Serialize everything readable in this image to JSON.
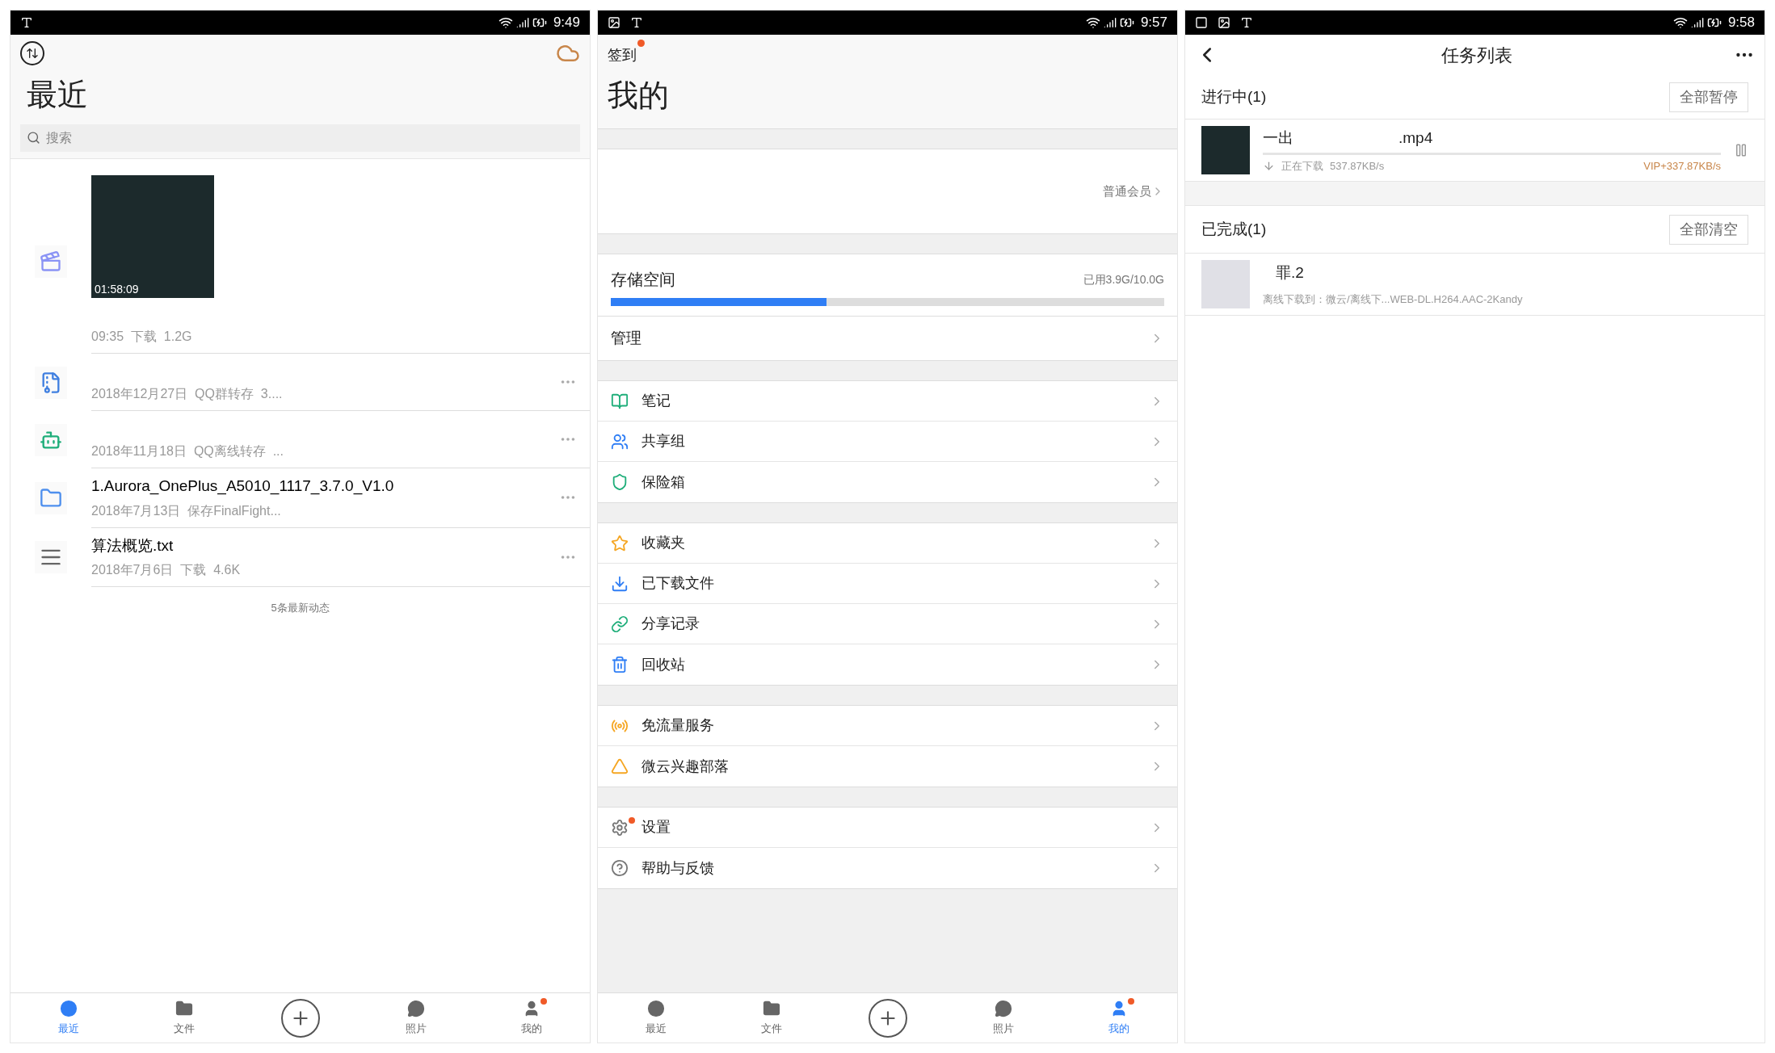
{
  "recent_screen": {
    "status_bar": {
      "time": "9:49"
    },
    "title": "最近",
    "search": {
      "placeholder": "搜索"
    },
    "items": [
      {
        "kind": "video",
        "duration": "01:58:09",
        "meta": "09:35  下载  1.2G"
      },
      {
        "kind": "archive",
        "meta": "2018年12月27日  QQ群转存  3...."
      },
      {
        "kind": "apk",
        "meta": "2018年11月18日  QQ离线转存  ..."
      },
      {
        "kind": "folder",
        "name": "1.Aurora_OnePlus_A5010_1117_3.7.0_V1.0",
        "meta": "2018年7月13日  保存FinalFight..."
      },
      {
        "kind": "text",
        "name": "算法概览.txt",
        "meta": "2018年7月6日  下载  4.6K"
      }
    ],
    "footer": "5条最新动态",
    "nav": [
      {
        "label": "最近",
        "selected": true,
        "badge": false
      },
      {
        "label": "文件",
        "selected": false,
        "badge": false
      },
      {
        "kind": "add"
      },
      {
        "label": "照片",
        "selected": false,
        "badge": false
      },
      {
        "label": "我的",
        "selected": false,
        "badge": true
      }
    ]
  },
  "me_screen": {
    "status_bar": {
      "time": "9:57"
    },
    "checkin": {
      "label": "签到",
      "badge": true
    },
    "title": "我的",
    "membership": "普通会员",
    "storage": {
      "label": "存储空间",
      "reading": "已用3.9G/10.0G",
      "level": 0.39
    },
    "manage": "管理",
    "groups": [
      [
        {
          "label": "笔记",
          "badge": false
        },
        {
          "label": "共享组",
          "badge": false
        },
        {
          "label": "保险箱",
          "badge": false
        }
      ],
      [
        {
          "label": "收藏夹",
          "badge": false
        },
        {
          "label": "已下载文件",
          "badge": false
        },
        {
          "label": "分享记录",
          "badge": false
        },
        {
          "label": "回收站",
          "badge": false
        }
      ],
      [
        {
          "label": "免流量服务",
          "badge": false
        },
        {
          "label": "微云兴趣部落",
          "badge": false
        }
      ],
      [
        {
          "label": "设置",
          "badge": true
        },
        {
          "label": "帮助与反馈",
          "badge": false
        }
      ]
    ],
    "nav": [
      {
        "label": "最近",
        "selected": false,
        "badge": false
      },
      {
        "label": "文件",
        "selected": false,
        "badge": false
      },
      {
        "kind": "add"
      },
      {
        "label": "照片",
        "selected": false,
        "badge": false
      },
      {
        "label": "我的",
        "selected": true,
        "badge": true
      }
    ]
  },
  "tasks_screen": {
    "status_bar": {
      "time": "9:58"
    },
    "title": "任务列表",
    "in_progress": {
      "heading": "进行中(1)",
      "button": "全部暂停",
      "task": {
        "name_start": "一出",
        "name_end": ".mp4",
        "level": 0.0,
        "status": "正在下载",
        "speed": "537.87KB/s",
        "vip_speed": "VIP+337.87KB/s"
      }
    },
    "completed": {
      "heading": "已完成(1)",
      "button": "全部清空",
      "task": {
        "name": "罪.2",
        "detail": "离线下载到：微云/离线下...WEB-DL.H264.AAC-2Kandy"
      }
    }
  }
}
